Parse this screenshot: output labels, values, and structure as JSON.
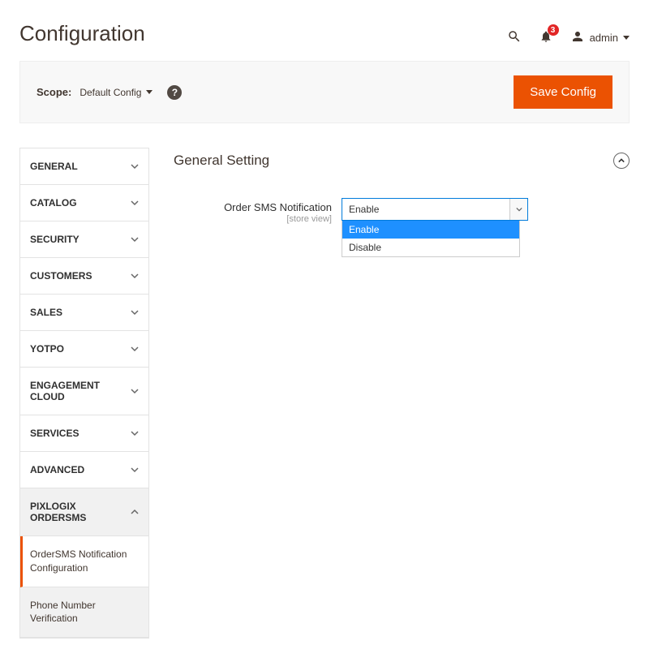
{
  "header": {
    "title": "Configuration",
    "badge_count": "3",
    "user_name": "admin"
  },
  "scope": {
    "label": "Scope:",
    "value": "Default Config",
    "save_label": "Save Config"
  },
  "sidebar": {
    "items": [
      {
        "label": "GENERAL"
      },
      {
        "label": "CATALOG"
      },
      {
        "label": "SECURITY"
      },
      {
        "label": "CUSTOMERS"
      },
      {
        "label": "SALES"
      },
      {
        "label": "YOTPO"
      },
      {
        "label": "ENGAGEMENT CLOUD"
      },
      {
        "label": "SERVICES"
      },
      {
        "label": "ADVANCED"
      },
      {
        "label": "PIXLOGIX ORDERSMS"
      }
    ],
    "sub": {
      "active": "OrderSMS Notification Configuration",
      "inactive": "Phone Number Verification"
    }
  },
  "main": {
    "section_title": "General Setting",
    "field_label": "Order SMS Notification",
    "field_scope": "[store view]",
    "selected": "Enable",
    "options": [
      "Enable",
      "Disable"
    ]
  }
}
